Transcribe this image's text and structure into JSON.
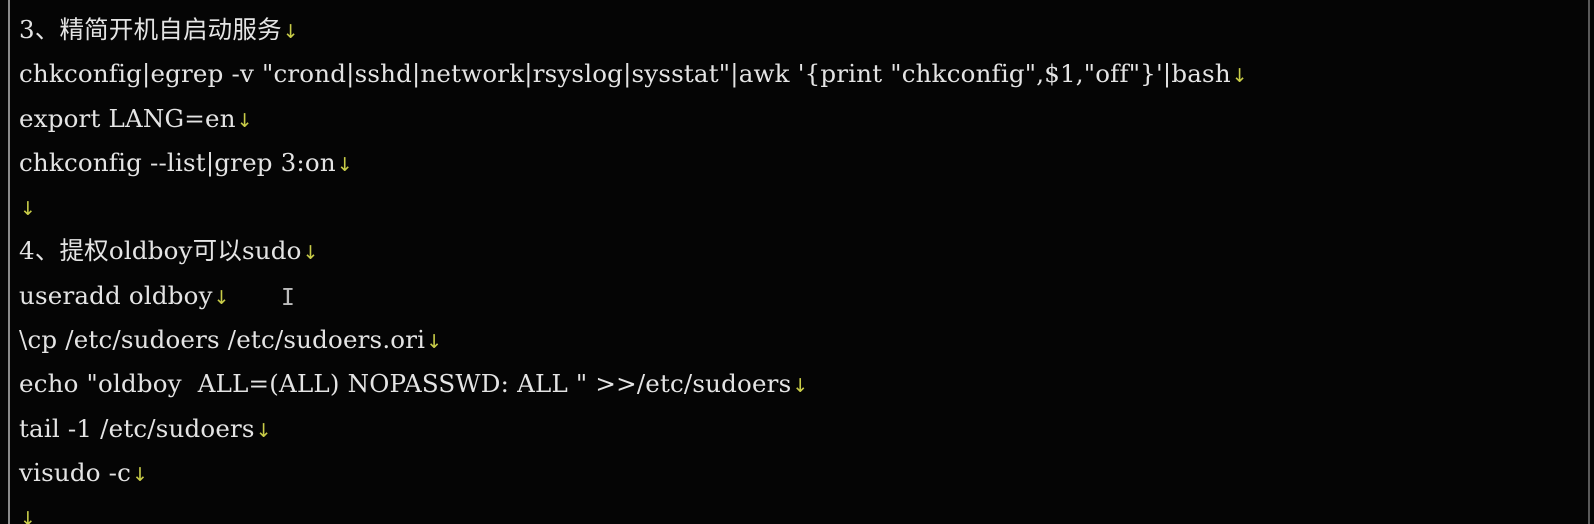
{
  "document": {
    "lines": [
      {
        "text": "3、精简开机自启动服务",
        "mark": "↓"
      },
      {
        "text": "chkconfig|egrep -v \"crond|sshd|network|rsyslog|sysstat\"|awk '{print \"chkconfig\",$1,\"off\"}'|bash",
        "mark": "↓"
      },
      {
        "text": "export LANG=en",
        "mark": "↓"
      },
      {
        "text": "chkconfig --list|grep 3:on",
        "mark": "↓"
      },
      {
        "text": "",
        "mark": "↓"
      },
      {
        "text": "4、提权oldboy可以sudo",
        "mark": "↓"
      },
      {
        "text": "useradd oldboy",
        "mark": "↓"
      },
      {
        "text": "\\cp /etc/sudoers /etc/sudoers.ori",
        "mark": "↓"
      },
      {
        "text": "echo \"oldboy  ALL=(ALL) NOPASSWD: ALL \" >>/etc/sudoers",
        "mark": "↓"
      },
      {
        "text": "tail -1 /etc/sudoers",
        "mark": "↓"
      },
      {
        "text": "visudo -c",
        "mark": "↓"
      },
      {
        "text": "",
        "mark": "↓"
      }
    ],
    "cursor_glyph": "I"
  },
  "colors": {
    "background": "#050505",
    "text": "#e4e4e4",
    "paragraph_mark": "#c8cc48",
    "border": "#8a8a8a"
  }
}
